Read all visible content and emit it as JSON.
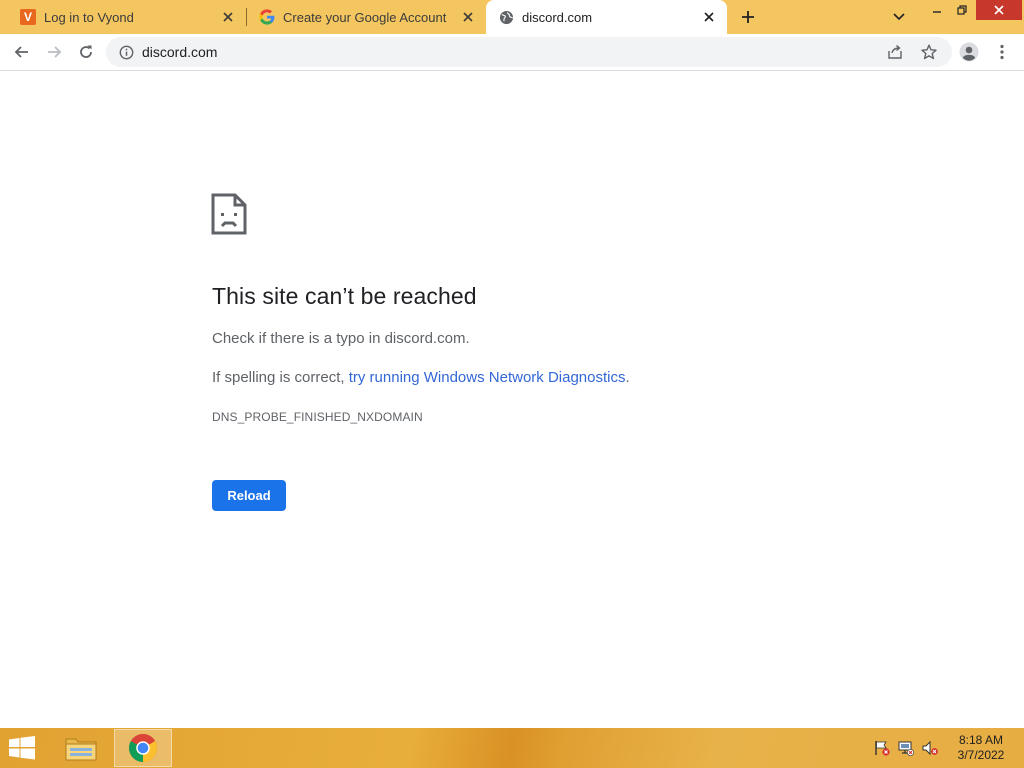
{
  "tabs": [
    {
      "title": "Log in to Vyond",
      "favicon": "vyond-icon",
      "favicon_letter": "V",
      "active": false
    },
    {
      "title": "Create your Google Account",
      "favicon": "google-icon",
      "active": false
    },
    {
      "title": "discord.com",
      "favicon": "globe-icon",
      "active": true
    }
  ],
  "toolbar": {
    "url": "discord.com"
  },
  "error": {
    "title": "This site can’t be reached",
    "p1": "Check if there is a typo in discord.com.",
    "p2_before": "If spelling is correct, ",
    "p2_link": "try running Windows Network Diagnostics",
    "p2_after": ".",
    "code": "DNS_PROBE_FINISHED_NXDOMAIN",
    "reload_label": "Reload"
  },
  "taskbar": {
    "time": "8:18 AM",
    "date": "3/7/2022"
  },
  "colors": {
    "tabstrip": "#f4c660",
    "reload_button": "#1a73e8",
    "link": "#3367d6",
    "close_button": "#c7372c"
  }
}
